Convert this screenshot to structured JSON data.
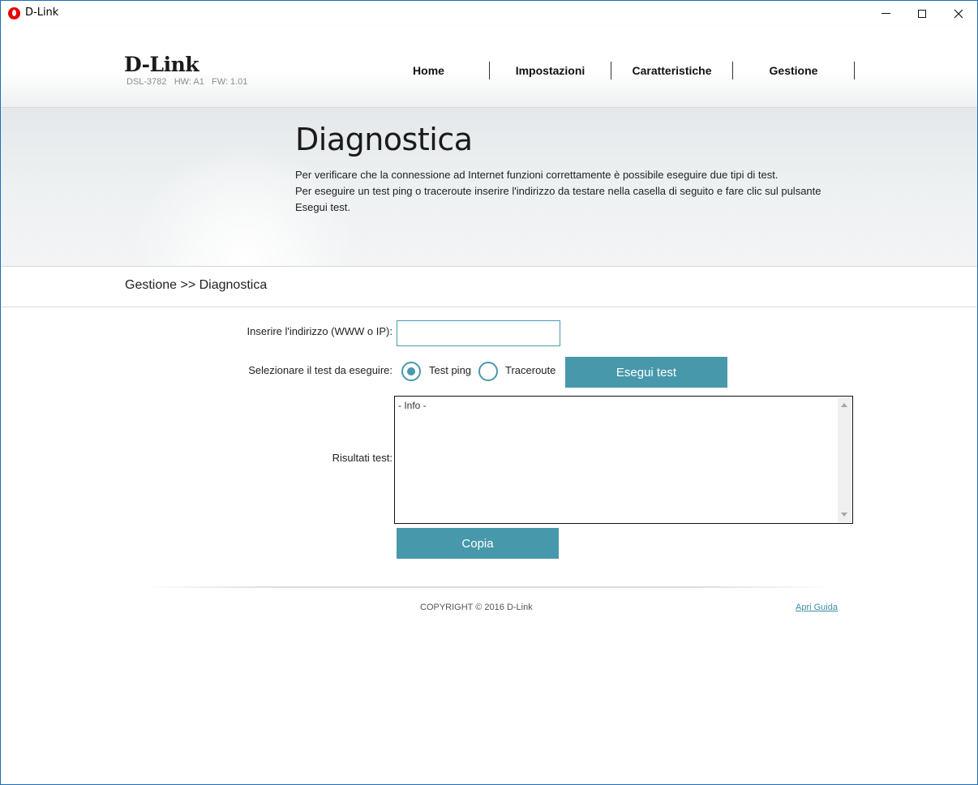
{
  "window": {
    "title": "D-Link",
    "app_icon": "vodafone-icon",
    "controls": [
      "minimize-icon",
      "maximize-icon",
      "close-icon"
    ]
  },
  "header": {
    "logo": "D-Link",
    "model": "DSL-3782",
    "hw": "HW: A1",
    "fw": "FW: 1.01",
    "nav": [
      "Home",
      "Impostazioni",
      "Caratteristiche",
      "Gestione"
    ]
  },
  "banner": {
    "title": "Diagnostica",
    "description_line1": "Per verificare che la connessione ad Internet funzioni correttamente è possibile eseguire due tipi di test.",
    "description_line2": "Per eseguire un test ping o traceroute inserire l'indirizzo da testare nella casella di seguito e fare clic sul pulsante",
    "description_line3": "Esegui test."
  },
  "breadcrumb": "Gestione >> Diagnostica",
  "form": {
    "address_label": "Inserire l'indirizzo (WWW o IP):",
    "address_value": "",
    "test_label": "Selezionare il test da eseguire:",
    "options": [
      {
        "label": "Test ping",
        "selected": true
      },
      {
        "label": "Traceroute",
        "selected": false
      }
    ],
    "run_button": "Esegui test",
    "results_label": "Risultati test:",
    "results_text": "- Info -",
    "copy_button": "Copia"
  },
  "footer": {
    "copyright": "COPYRIGHT © 2016 D-Link",
    "help_link": "Apri Guida"
  },
  "colors": {
    "accent": "#4898ab",
    "window_border": "#1e6fb5",
    "link": "#3a8ea3"
  }
}
